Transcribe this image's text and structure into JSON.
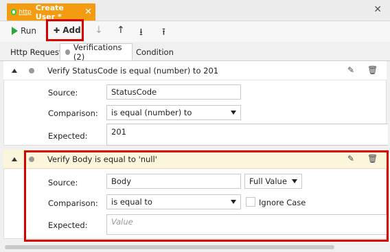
{
  "tab": {
    "badge": "http",
    "title": "Create User *",
    "close": "✕"
  },
  "window_close": "✕",
  "toolbar": {
    "run_label": "Run",
    "add_label": "Add",
    "add_glyph": "✚",
    "move_down": "↓",
    "move_up": "↑",
    "collapse_all": "⭳",
    "expand_all": "⭱"
  },
  "subtabs": [
    {
      "label": "Http Request"
    },
    {
      "label": "Verifications (2)"
    },
    {
      "label": "Condition"
    }
  ],
  "verifications": [
    {
      "title": "Verify StatusCode is equal (number) to 201",
      "source_label": "Source:",
      "source_value": "StatusCode",
      "comparison_label": "Comparison:",
      "comparison_value": "is equal (number) to",
      "expected_label": "Expected:",
      "expected_value": "201"
    },
    {
      "title": "Verify Body is equal to 'null'",
      "source_label": "Source:",
      "source_value": "Body",
      "source_mode": "Full Value",
      "comparison_label": "Comparison:",
      "comparison_value": "is equal to",
      "ignore_case_label": "Ignore Case",
      "ignore_case_checked": false,
      "expected_label": "Expected:",
      "expected_placeholder": "Value"
    }
  ],
  "colors": {
    "tab_accent": "#f39c12",
    "highlight": "#d60000",
    "run_green": "#2aa63a"
  }
}
